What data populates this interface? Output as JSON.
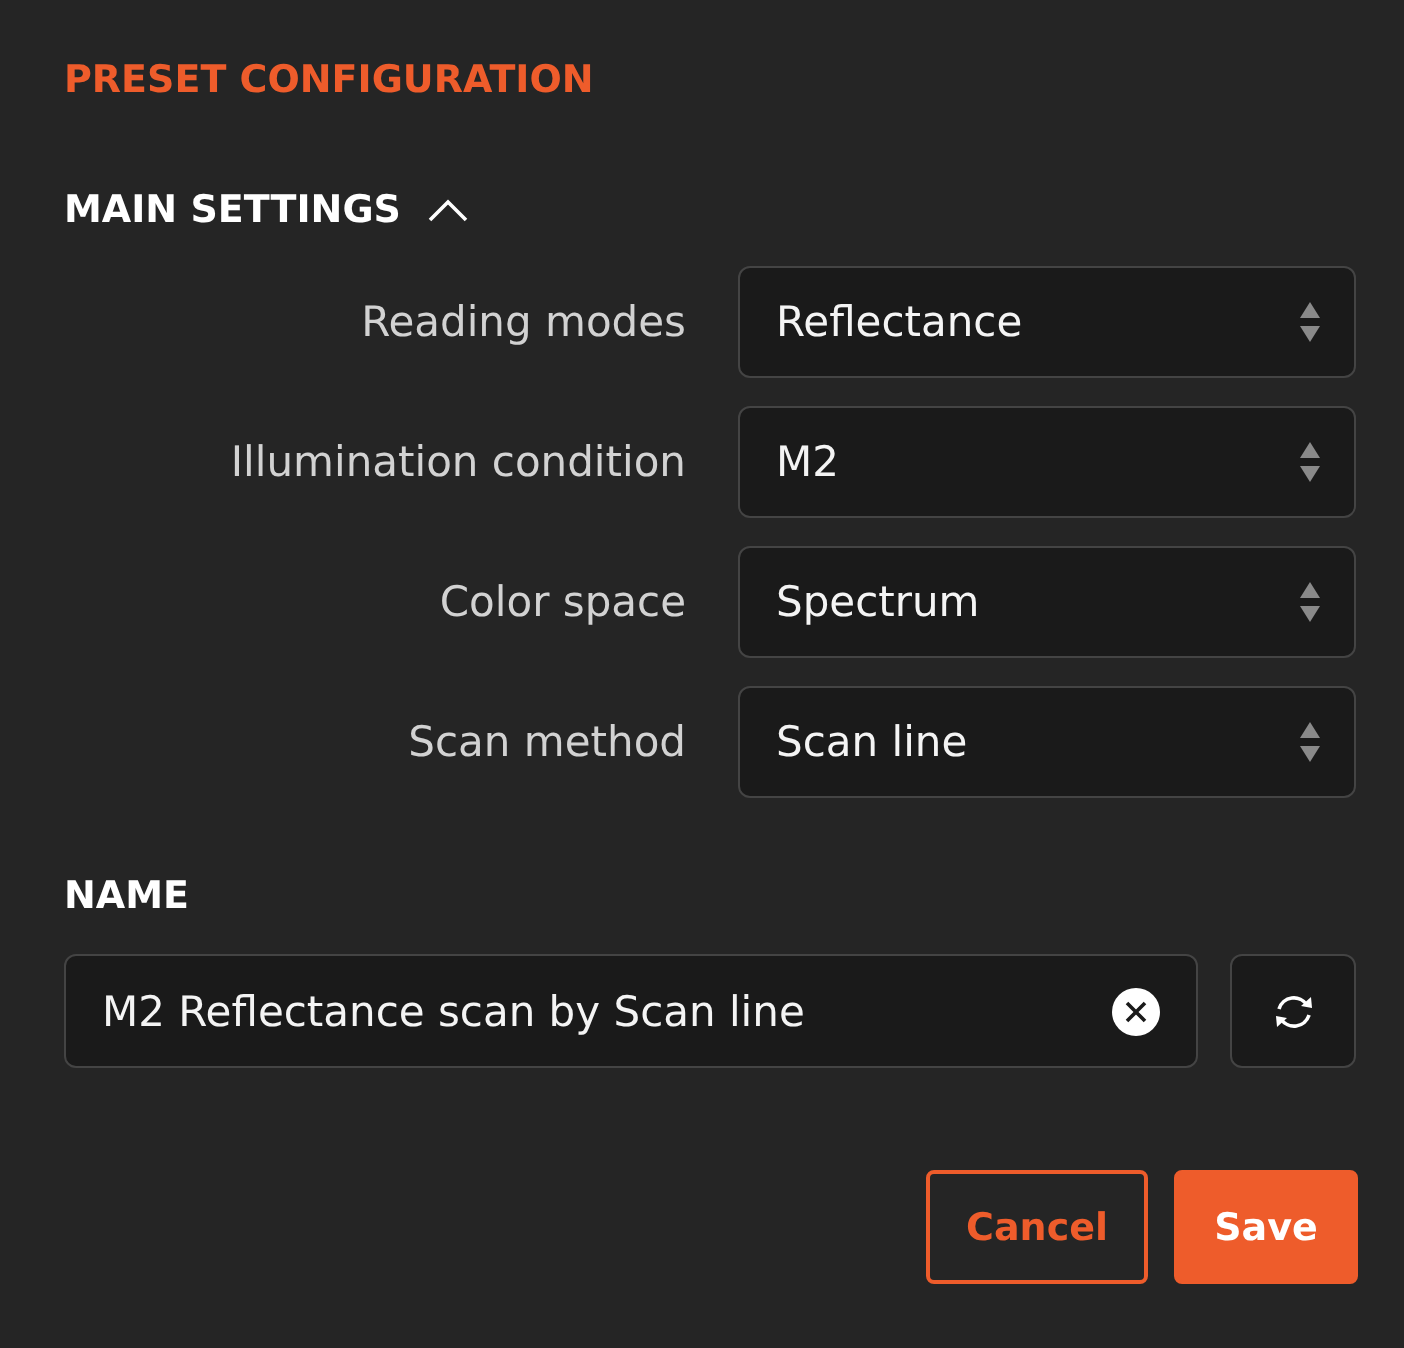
{
  "title": "PRESET CONFIGURATION",
  "main_settings": {
    "heading": "MAIN SETTINGS",
    "expanded": true,
    "fields": [
      {
        "label": "Reading modes",
        "value": "Reflectance"
      },
      {
        "label": "Illumination condition",
        "value": "M2"
      },
      {
        "label": "Color space",
        "value": "Spectrum"
      },
      {
        "label": "Scan method",
        "value": "Scan line"
      }
    ]
  },
  "name": {
    "label": "NAME",
    "value": "M2 Reflectance scan by Scan line"
  },
  "buttons": [
    {
      "label": "Cancel",
      "kind": "secondary"
    },
    {
      "label": "Save",
      "kind": "primary"
    }
  ]
}
